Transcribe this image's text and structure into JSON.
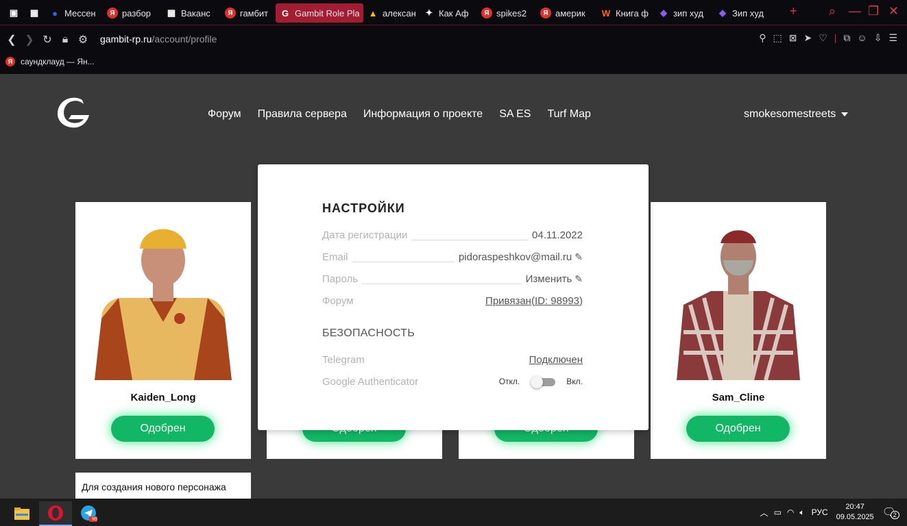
{
  "browser": {
    "tabs": [
      {
        "label": "",
        "color": "#ffffff",
        "icon": "picture-icon"
      },
      {
        "label": "",
        "color": "#ffffff",
        "icon": "grid-icon"
      },
      {
        "label": "Мессен",
        "color": "#1e6cf0",
        "icon": "messenger-icon"
      },
      {
        "label": "разбор",
        "color": "#e0302a",
        "icon": "yandex-icon"
      },
      {
        "label": "Ваканс",
        "color": "#ffffff",
        "icon": "grid-icon"
      },
      {
        "label": "гамбит",
        "color": "#e0302a",
        "icon": "yandex-icon"
      },
      {
        "label": "Gambit Role Pla",
        "color": "#ffffff",
        "icon": "gambit-icon",
        "active": true
      },
      {
        "label": "алексан",
        "color": "#f2c200",
        "icon": "image-icon"
      },
      {
        "label": "Как Аф",
        "color": "#ffffff",
        "icon": "spark-icon"
      },
      {
        "label": "spikes2",
        "color": "#e0302a",
        "icon": "yandex-icon"
      },
      {
        "label": "америк",
        "color": "#e0302a",
        "icon": "yandex-icon"
      },
      {
        "label": "Книга ф",
        "color": "#ff6a00",
        "icon": "w-icon"
      },
      {
        "label": "зип худ",
        "color": "#8a5cf6",
        "icon": "figma-icon"
      },
      {
        "label": "Зип худ",
        "color": "#8a5cf6",
        "icon": "figma-icon"
      }
    ],
    "url_host": "gambit-rp.ru",
    "url_path": "/account/profile",
    "bookmark": "саундклауд — Ян..."
  },
  "site": {
    "nav": [
      "Форум",
      "Правила сервера",
      "Информация о проекте",
      "SA ES",
      "Turf Map"
    ],
    "username": "smokesomestreets"
  },
  "characters": [
    {
      "name": "Kaiden_Long",
      "status": "Одобрен"
    },
    {
      "name": "",
      "status": "Одобрен"
    },
    {
      "name": "",
      "status": "Одобрен"
    },
    {
      "name": "Sam_Cline",
      "status": "Одобрен"
    }
  ],
  "note_text": "Для создания нового персонажа",
  "settings": {
    "title": "НАСТРОЙКИ",
    "reg_label": "Дата регистрации",
    "reg_value": "04.11.2022",
    "email_label": "Email",
    "email_value": "pidoraspeshkov@mail.ru",
    "password_label": "Пароль",
    "password_value": "Изменить",
    "forum_label": "Форум",
    "forum_value": "Привязан(ID: 98993)",
    "security_title": "БЕЗОПАСНОСТЬ",
    "telegram_label": "Telegram",
    "telegram_value": "Подключен",
    "ga_label": "Google Authenticator",
    "ga_off": "Откл.",
    "ga_on": "Вкл.",
    "ga_enabled": false
  },
  "taskbar": {
    "lang": "РУС",
    "time": "20:47",
    "date": "09.05.2025",
    "notifications": "2",
    "telegram_badge": "95"
  }
}
